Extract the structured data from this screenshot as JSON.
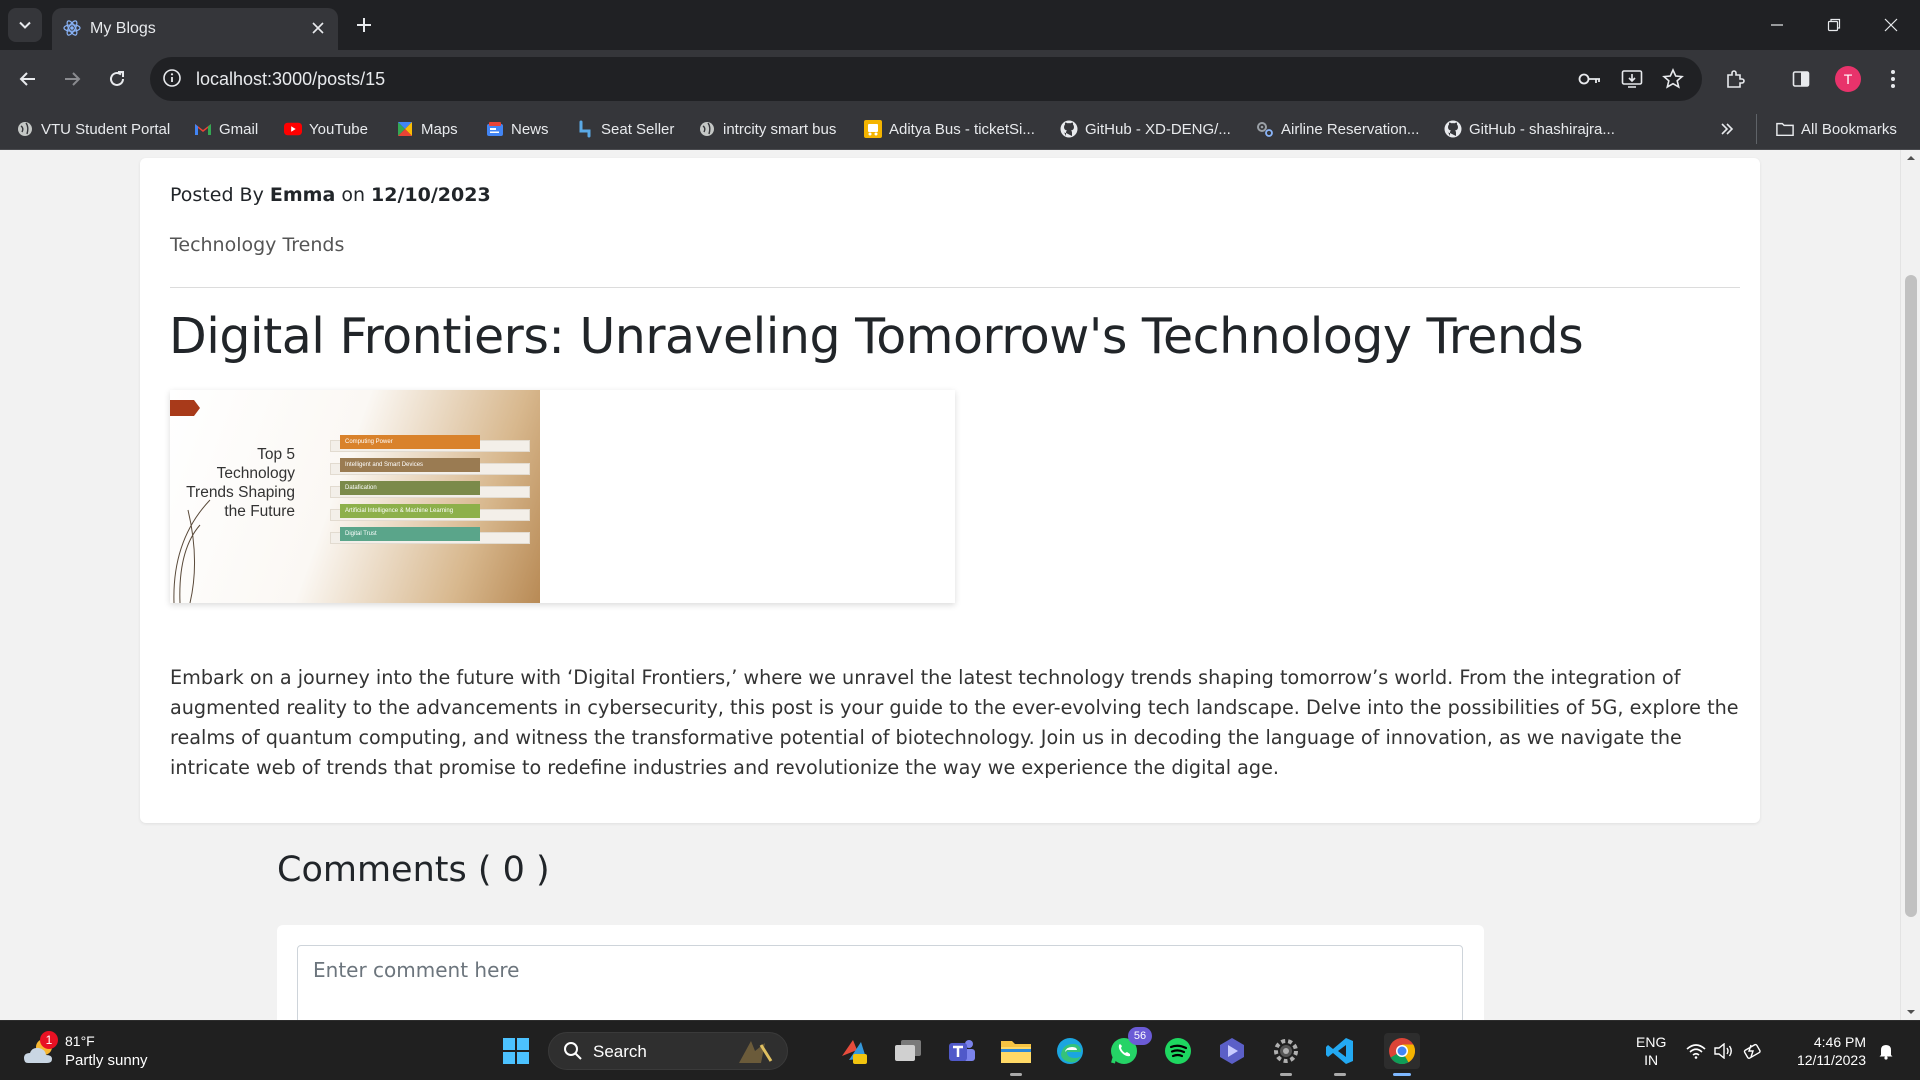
{
  "browser": {
    "tab_title": "My Blogs",
    "url": "localhost:3000/posts/15",
    "profile_initial": "T"
  },
  "bookmarks": [
    {
      "label": "VTU Student Portal",
      "icon": "globe-icon"
    },
    {
      "label": "Gmail",
      "icon": "gmail-icon"
    },
    {
      "label": "YouTube",
      "icon": "youtube-icon"
    },
    {
      "label": "Maps",
      "icon": "maps-icon"
    },
    {
      "label": "News",
      "icon": "news-icon"
    },
    {
      "label": "Seat Seller",
      "icon": "seat-seller-icon"
    },
    {
      "label": "intrcity smart bus",
      "icon": "globe-icon"
    },
    {
      "label": "Aditya Bus - ticketSi...",
      "icon": "bus-icon"
    },
    {
      "label": "GitHub - XD-DENG/...",
      "icon": "github-icon"
    },
    {
      "label": "Airline Reservation...",
      "icon": "gears-icon"
    },
    {
      "label": "GitHub - shashirajra...",
      "icon": "github-icon"
    }
  ],
  "bookmarks_all_label": "All Bookmarks",
  "post": {
    "posted_by_prefix": "Posted By",
    "author": "Emma",
    "on_word": "on",
    "date": "12/10/2023",
    "category": "Technology Trends",
    "title": "Digital Frontiers: Unraveling Tomorrow's Technology Trends",
    "image": {
      "heading": "Top 5 Technology Trends Shaping the Future",
      "heading_lines": [
        "Top 5",
        "Technology",
        "Trends Shaping",
        "the Future"
      ],
      "bars": [
        {
          "label": "Computing Power",
          "color": "#d9822b"
        },
        {
          "label": "Intelligent and Smart Devices",
          "color": "#9a7b52"
        },
        {
          "label": "Datafication",
          "color": "#7b8a4a"
        },
        {
          "label": "Artificial Intelligence & Machine Learning",
          "color": "#8db04a"
        },
        {
          "label": "Digital Trust",
          "color": "#5aa58a"
        }
      ]
    },
    "body": "Embark on a journey into the future with ‘Digital Frontiers,’ where we unravel the latest technology trends shaping tomorrow’s world. From the integration of augmented reality to the advancements in cybersecurity, this post is your guide to the ever-evolving tech landscape. Delve into the possibilities of 5G, explore the realms of quantum computing, and witness the transformative potential of biotechnology. Join us in decoding the language of innovation, as we navigate the intricate web of trends that promise to redefine industries and revolutionize the way we experience the digital age."
  },
  "comments": {
    "heading": "Comments ( 0 )",
    "placeholder": "Enter comment here"
  },
  "taskbar": {
    "weather_temp": "81°F",
    "weather_condition": "Partly sunny",
    "weather_badge": "1",
    "search_label": "Search",
    "whatsapp_badge": "56",
    "lang_top": "ENG",
    "lang_bottom": "IN",
    "time": "4:46 PM",
    "date": "12/11/2023"
  }
}
